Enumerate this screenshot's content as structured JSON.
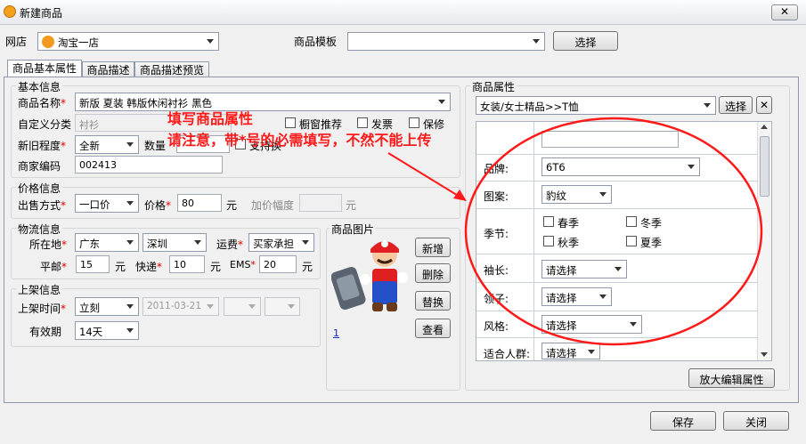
{
  "window": {
    "title": "新建商品",
    "close": "✕"
  },
  "top": {
    "shop_label": "网店",
    "shop_value": "淘宝一店",
    "template_label": "商品模板",
    "template_value": "",
    "select_btn": "选择"
  },
  "tabs": [
    "商品基本属性",
    "商品描述",
    "商品描述预览"
  ],
  "basic": {
    "title": "基本信息",
    "name_label": "商品名称",
    "name_value": "新版 夏装 韩版休闲衬衫 黑色",
    "category_label": "自定义分类",
    "category_value": "衬衫",
    "showcase_label": "橱窗推荐",
    "invoice_label": "发票",
    "warranty_label": "保修",
    "condition_label": "新旧程度",
    "condition_value": "全新",
    "qty_label": "数量",
    "exchange_label": "支持换",
    "code_label": "商家编码",
    "code_value": "002413"
  },
  "price": {
    "title": "价格信息",
    "mode_label": "出售方式",
    "mode_value": "一口价",
    "price_label": "价格",
    "price_value": "80",
    "unit": "元",
    "increment_label": "加价幅度",
    "increment_unit": "元"
  },
  "logistics": {
    "title": "物流信息",
    "location_label": "所在地",
    "province": "广东",
    "city": "深圳",
    "freight_label": "运费",
    "freight_value": "买家承担",
    "mail_label": "平邮",
    "mail_value": "15",
    "express_label": "快递",
    "express_value": "10",
    "ems_label": "EMS",
    "ems_value": "20",
    "unit": "元"
  },
  "listing": {
    "title": "上架信息",
    "time_label": "上架时间",
    "time_value": "立刻",
    "date_value": "2011-03-21",
    "valid_label": "有效期",
    "valid_value": "14天"
  },
  "image": {
    "title": "商品图片",
    "page_link": "1",
    "add": "新增",
    "delete": "删除",
    "replace": "替换",
    "view": "查看"
  },
  "attributes": {
    "title": "商品属性",
    "category": "女装/女士精品>>T恤",
    "select_btn": "选择",
    "clear_btn": "✕",
    "brand_label": "品牌:",
    "brand_value": "6T6",
    "pattern_label": "图案:",
    "pattern_value": "豹纹",
    "season_label": "季节:",
    "seasons": [
      "春季",
      "冬季",
      "秋季",
      "夏季"
    ],
    "sleeve_label": "袖长:",
    "sleeve_value": "请选择",
    "collar_label": "领子:",
    "collar_value": "请选择",
    "style_label": "风格:",
    "style_value": "请选择",
    "crowd_label": "适合人群:",
    "crowd_value": "请选择",
    "enlarge_btn": "放大编辑属性"
  },
  "annotation": {
    "line1": "填写商品属性",
    "line2": "请注意，带*号的必需填写，不然不能上传",
    "color": "#ff1a1a"
  },
  "footer": {
    "save": "保存",
    "close": "关闭"
  }
}
